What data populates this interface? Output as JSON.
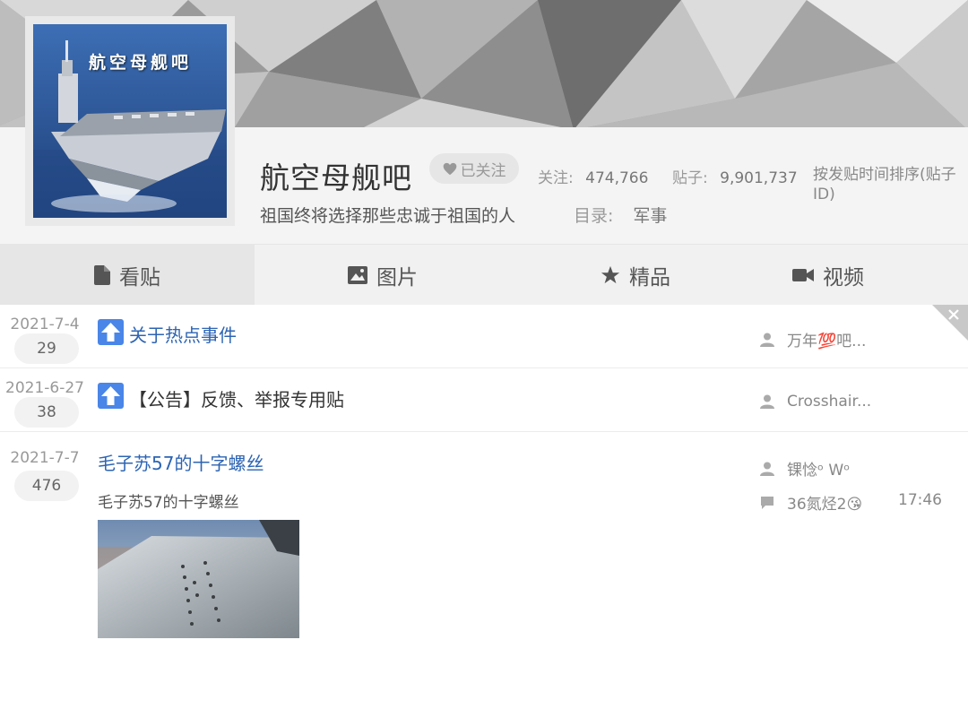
{
  "logo": {
    "text": "航空母舰吧"
  },
  "forum": {
    "name": "航空母舰吧",
    "follow_label": "已关注",
    "followers_label": "关注:",
    "followers_value": "474,766",
    "posts_label": "贴子:",
    "posts_value": "9,901,737",
    "sort_label": "按发贴时间排序(贴子ID)",
    "slogan": "祖国终将选择那些忠诚于祖国的人",
    "catalog_label": "目录:",
    "catalog_value": "军事"
  },
  "tabs": [
    {
      "label": "看贴",
      "icon": "document-icon"
    },
    {
      "label": "图片",
      "icon": "image-icon"
    },
    {
      "label": "精品",
      "icon": "star-icon"
    },
    {
      "label": "视频",
      "icon": "video-camera-icon"
    }
  ],
  "posts": [
    {
      "date": "2021-7-4",
      "replies": "29",
      "title": "关于热点事件",
      "author": "万年💯吧..."
    },
    {
      "date": "2021-6-27",
      "replies": "38",
      "title": "【公告】反馈、举报专用贴",
      "author": "Crosshair..."
    },
    {
      "date": "2021-7-7",
      "replies": "476",
      "title": "毛子苏57的十字螺丝",
      "author": "锞惗ᵒ Wᵒ",
      "abstract": "毛子苏57的十字螺丝",
      "last_reply_user": "36氮烃2😘",
      "last_reply_time": "17:46"
    }
  ],
  "colors": {
    "link": "#2d64b3",
    "pin": "#4a86e8"
  }
}
